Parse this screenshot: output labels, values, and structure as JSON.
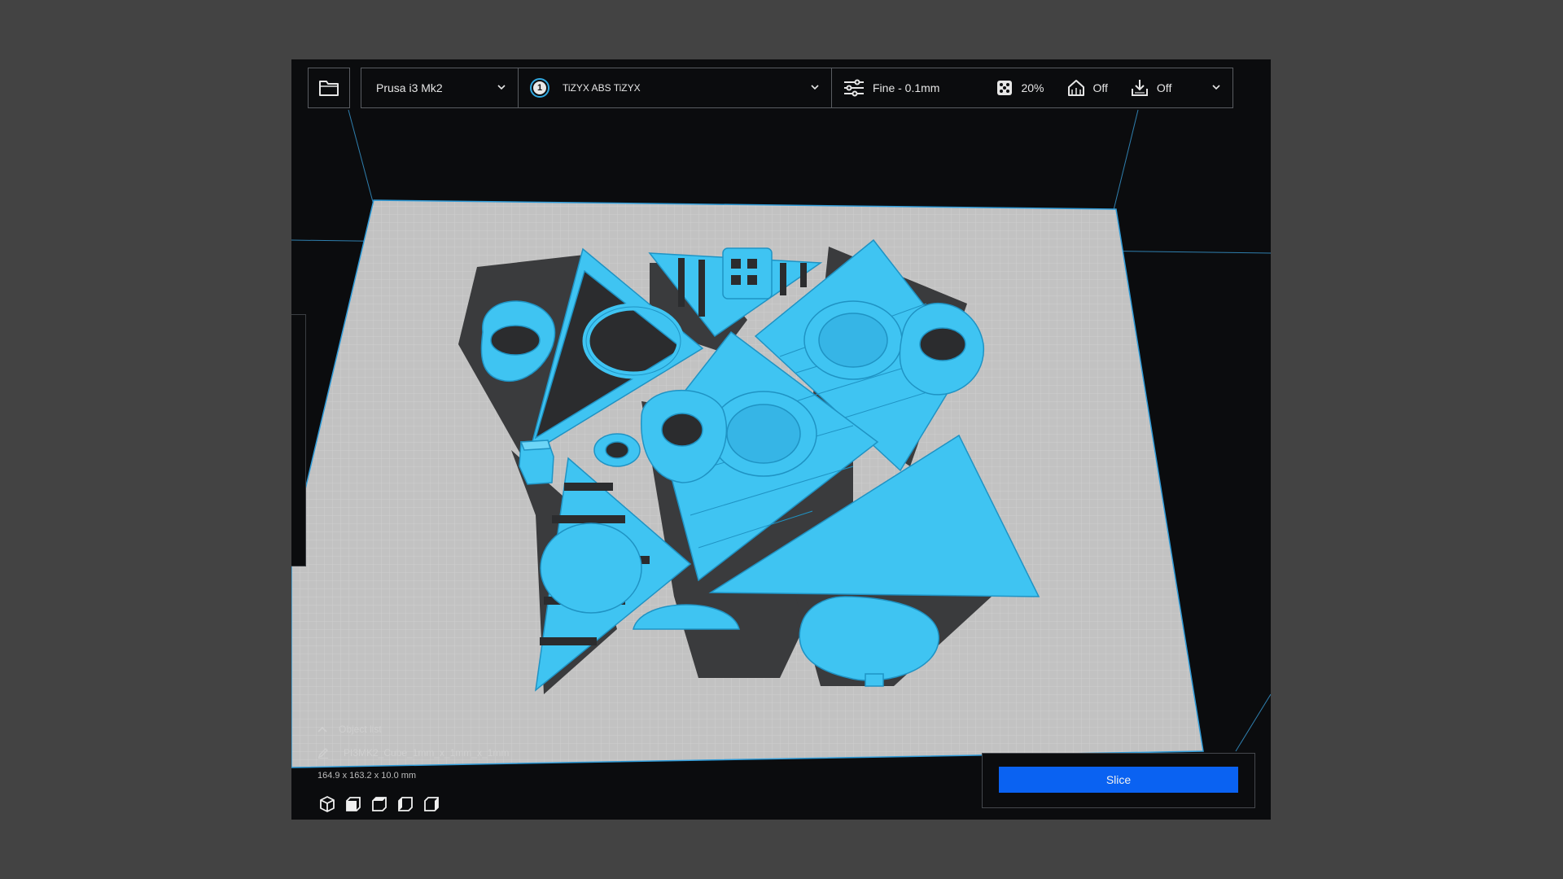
{
  "toolbar": {
    "open_icon": "folder-icon",
    "printer": {
      "label": "Prusa i3 Mk2",
      "icon": "chevron-down-icon"
    },
    "material": {
      "extruder_number": "1",
      "label": "TiZYX ABS TiZYX"
    },
    "print_settings": {
      "profile": "Fine - 0.1mm",
      "infill": "20%",
      "support": "Off",
      "adhesion": "Off"
    }
  },
  "object_list": {
    "header": "Object list",
    "item_name": "PI3MK2_Cube_1mm_x_1mm_x_1mm",
    "dimensions": "164.9 x 163.2 x 10.0 mm"
  },
  "view_buttons": [
    "3d-view-icon",
    "front-view-icon",
    "top-view-icon",
    "left-view-icon",
    "right-view-icon"
  ],
  "slice": {
    "label": "Slice"
  },
  "colors": {
    "model": "#3fc4f2",
    "model_dark": "#2aa7d6",
    "build_plate": "#c7c7c7",
    "background": "#0b0c0e",
    "accent": "#0a62f2"
  }
}
